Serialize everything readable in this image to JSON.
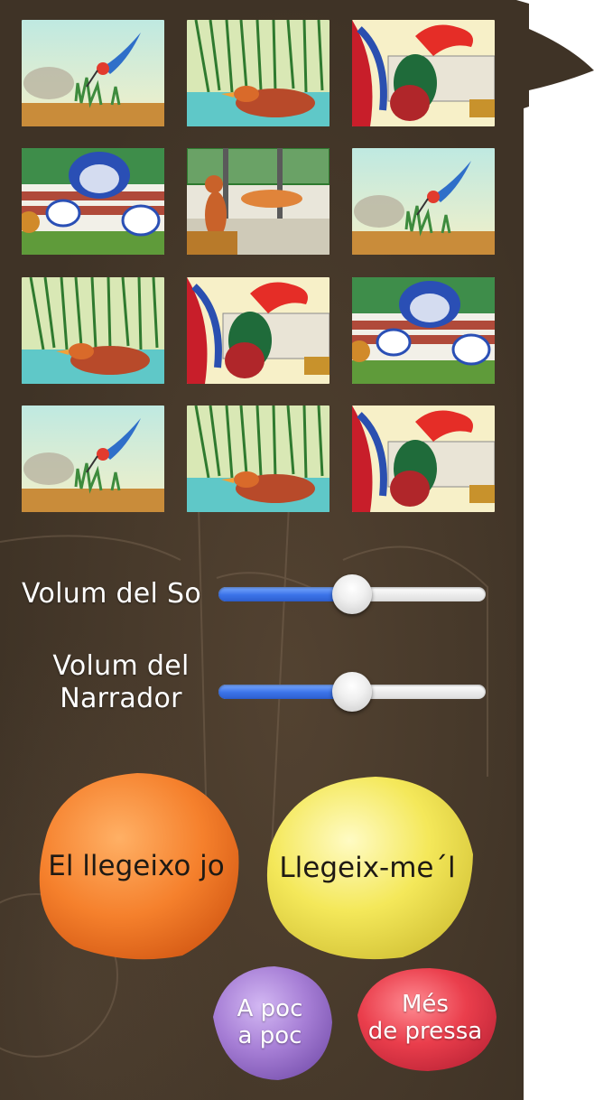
{
  "gallery": {
    "thumbnails": [
      {
        "scene": "bird"
      },
      {
        "scene": "duck"
      },
      {
        "scene": "rooster"
      },
      {
        "scene": "cows"
      },
      {
        "scene": "cats"
      },
      {
        "scene": "bird"
      },
      {
        "scene": "duck"
      },
      {
        "scene": "rooster"
      },
      {
        "scene": "cows"
      },
      {
        "scene": "bird"
      },
      {
        "scene": "duck"
      },
      {
        "scene": "rooster"
      }
    ]
  },
  "sound_volume": {
    "label": "Volum del So",
    "value": 0.5
  },
  "narrator_volume": {
    "label_line1": "Volum del",
    "label_line2": "Narrador",
    "value": 0.5
  },
  "buttons": {
    "read_myself": "El llegeixo jo",
    "read_to_me": "Llegeix-me´l",
    "slow_line1": "A poc",
    "slow_line2": "a poc",
    "fast_line1": "Més",
    "fast_line2": "de pressa"
  },
  "colors": {
    "panel": "#3f3326",
    "orange": "#f5802c",
    "yellow": "#f4e85a",
    "purple": "#a77fd6",
    "red": "#ea3e4c",
    "slider_blue": "#3b73e8"
  }
}
